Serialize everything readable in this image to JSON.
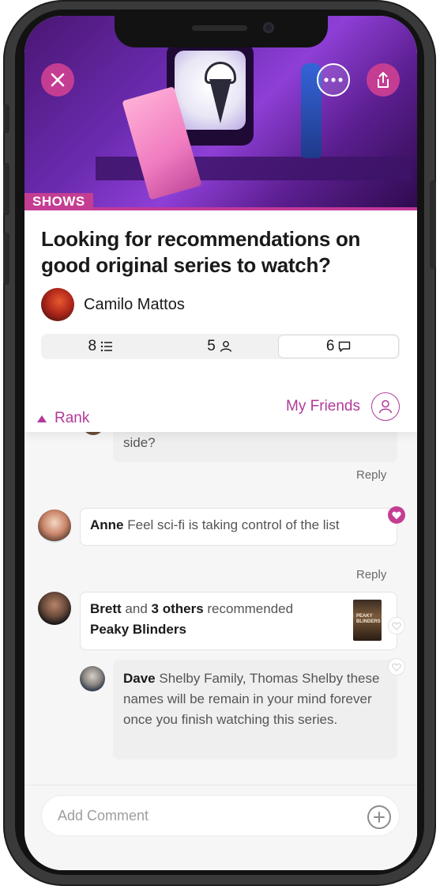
{
  "hero": {
    "category_tag": "SHOWS"
  },
  "post": {
    "title": "Looking for recommendations on good original series to watch?",
    "author": "Camilo Mattos"
  },
  "stats": [
    {
      "count": "8",
      "icon": "list-icon"
    },
    {
      "count": "5",
      "icon": "person-icon"
    },
    {
      "count": "6",
      "icon": "comment-icon",
      "active": true
    }
  ],
  "sort": {
    "rank_label": "Rank",
    "friends_label": "My Friends"
  },
  "comments": {
    "partial_text": "side?",
    "reply_label": "Reply",
    "anne": {
      "name": "Anne",
      "text": "Feel sci-fi is taking control of the list"
    },
    "brett": {
      "name": "Brett",
      "connector": "and",
      "others": "3 others",
      "action": "recommended",
      "show": "Peaky Blinders",
      "thumb_text": "PEAKY BLINDERS"
    },
    "dave": {
      "name": "Dave",
      "text": "Shelby Family, Thomas Shelby these names will be remain in your mind forever once you finish watching this series."
    }
  },
  "composer": {
    "placeholder": "Add Comment"
  },
  "colors": {
    "accent": "#c43d93",
    "text": "#1a1a1a",
    "muted": "#555555"
  }
}
